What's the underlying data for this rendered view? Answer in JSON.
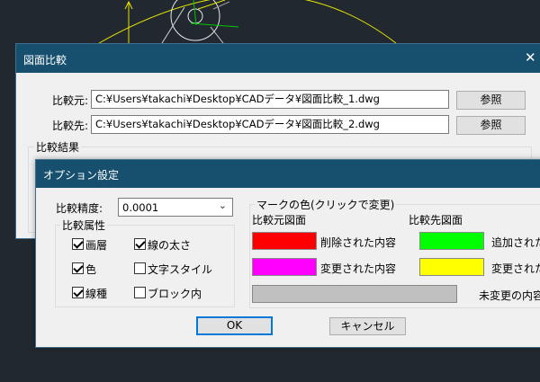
{
  "compare_dialog": {
    "title": "図面比較",
    "close_glyph": "✕",
    "source_label": "比較元:",
    "source_path": "C:¥Users¥takachi¥Desktop¥CADデータ¥図面比較_1.dwg",
    "target_label": "比較先:",
    "target_path": "C:¥Users¥takachi¥Desktop¥CADデータ¥図面比較_2.dwg",
    "browse_label": "参照",
    "result_group_label": "比較結果"
  },
  "options_dialog": {
    "title": "オプション設定",
    "precision_label": "比較精度:",
    "precision_value": "0.0001",
    "attributes_group_label": "比較属性",
    "attributes": [
      {
        "label": "画層",
        "checked": true
      },
      {
        "label": "線の太さ",
        "checked": true
      },
      {
        "label": "色",
        "checked": true
      },
      {
        "label": "文字スタイル",
        "checked": false
      },
      {
        "label": "線種",
        "checked": true
      },
      {
        "label": "ブロック内",
        "checked": false
      }
    ],
    "mark_color_group_label": "マークの色(クリックで変更)",
    "source_drawing_label": "比較元図面",
    "target_drawing_label": "比較先図面",
    "deleted_label": "削除された内容",
    "deleted_color": "#ff0000",
    "changed_source_label": "変更された内容",
    "changed_source_color": "#ff00ff",
    "added_label": "追加された",
    "added_color": "#00ff00",
    "changed_target_label": "変更された",
    "changed_target_color": "#ffff00",
    "unchanged_label": "未変更の内容",
    "unchanged_color": "#c0c0c0",
    "ok_label": "OK",
    "cancel_label": "キャンセル"
  },
  "colors": {
    "titlebar": "#17506e",
    "cad_background": "#212830",
    "cad_yellow": "#f0f000",
    "cad_green": "#00c800"
  }
}
